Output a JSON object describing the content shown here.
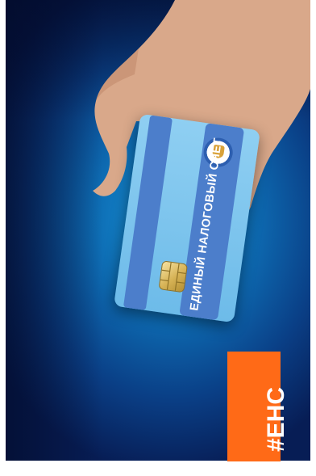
{
  "card": {
    "title": "ЕДИНЫЙ НАЛОГОВЫЙ СЧЕТ",
    "emblem_icon": "tax-service-emblem-icon",
    "chip_icon": "card-chip-icon"
  },
  "badge": {
    "text": "#ЕНС",
    "color": "#ff6a17"
  },
  "colors": {
    "background": "#0a3f86",
    "card_light": "#7fc6ee",
    "card_stripe": "#4c7ecb"
  }
}
